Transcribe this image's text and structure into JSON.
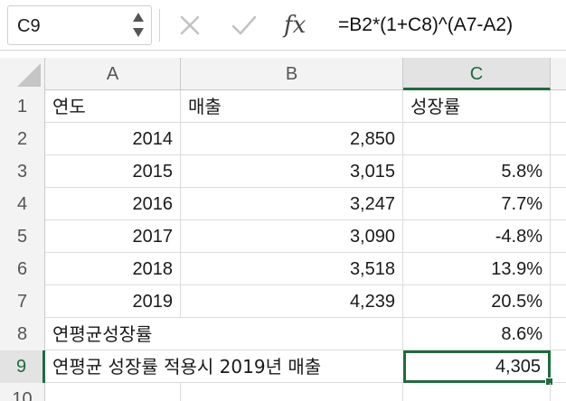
{
  "formula_bar": {
    "name_box": "C9",
    "formula": "=B2*(1+C8)^(A7-A2)",
    "fx_label": "fx"
  },
  "columns": [
    "A",
    "B",
    "C"
  ],
  "rows": [
    {
      "num": "1",
      "a": "연도",
      "b": "매출",
      "c": "성장률"
    },
    {
      "num": "2",
      "a": "2014",
      "b": "2,850",
      "c": ""
    },
    {
      "num": "3",
      "a": "2015",
      "b": "3,015",
      "c": "5.8%"
    },
    {
      "num": "4",
      "a": "2016",
      "b": "3,247",
      "c": "7.7%"
    },
    {
      "num": "5",
      "a": "2017",
      "b": "3,090",
      "c": "-4.8%"
    },
    {
      "num": "6",
      "a": "2018",
      "b": "3,518",
      "c": "13.9%"
    },
    {
      "num": "7",
      "a": "2019",
      "b": "4,239",
      "c": "20.5%"
    },
    {
      "num": "8",
      "a": "연평균성장률",
      "b": "",
      "c": "8.6%"
    },
    {
      "num": "9",
      "a": "연평균 성장률 적용시 2019년 매출",
      "b": "",
      "c": "4,305"
    },
    {
      "num": "10",
      "a": "",
      "b": "",
      "c": ""
    }
  ],
  "colors": {
    "selection_green": "#1e6b3e",
    "header_bg": "#f3f3f3"
  }
}
